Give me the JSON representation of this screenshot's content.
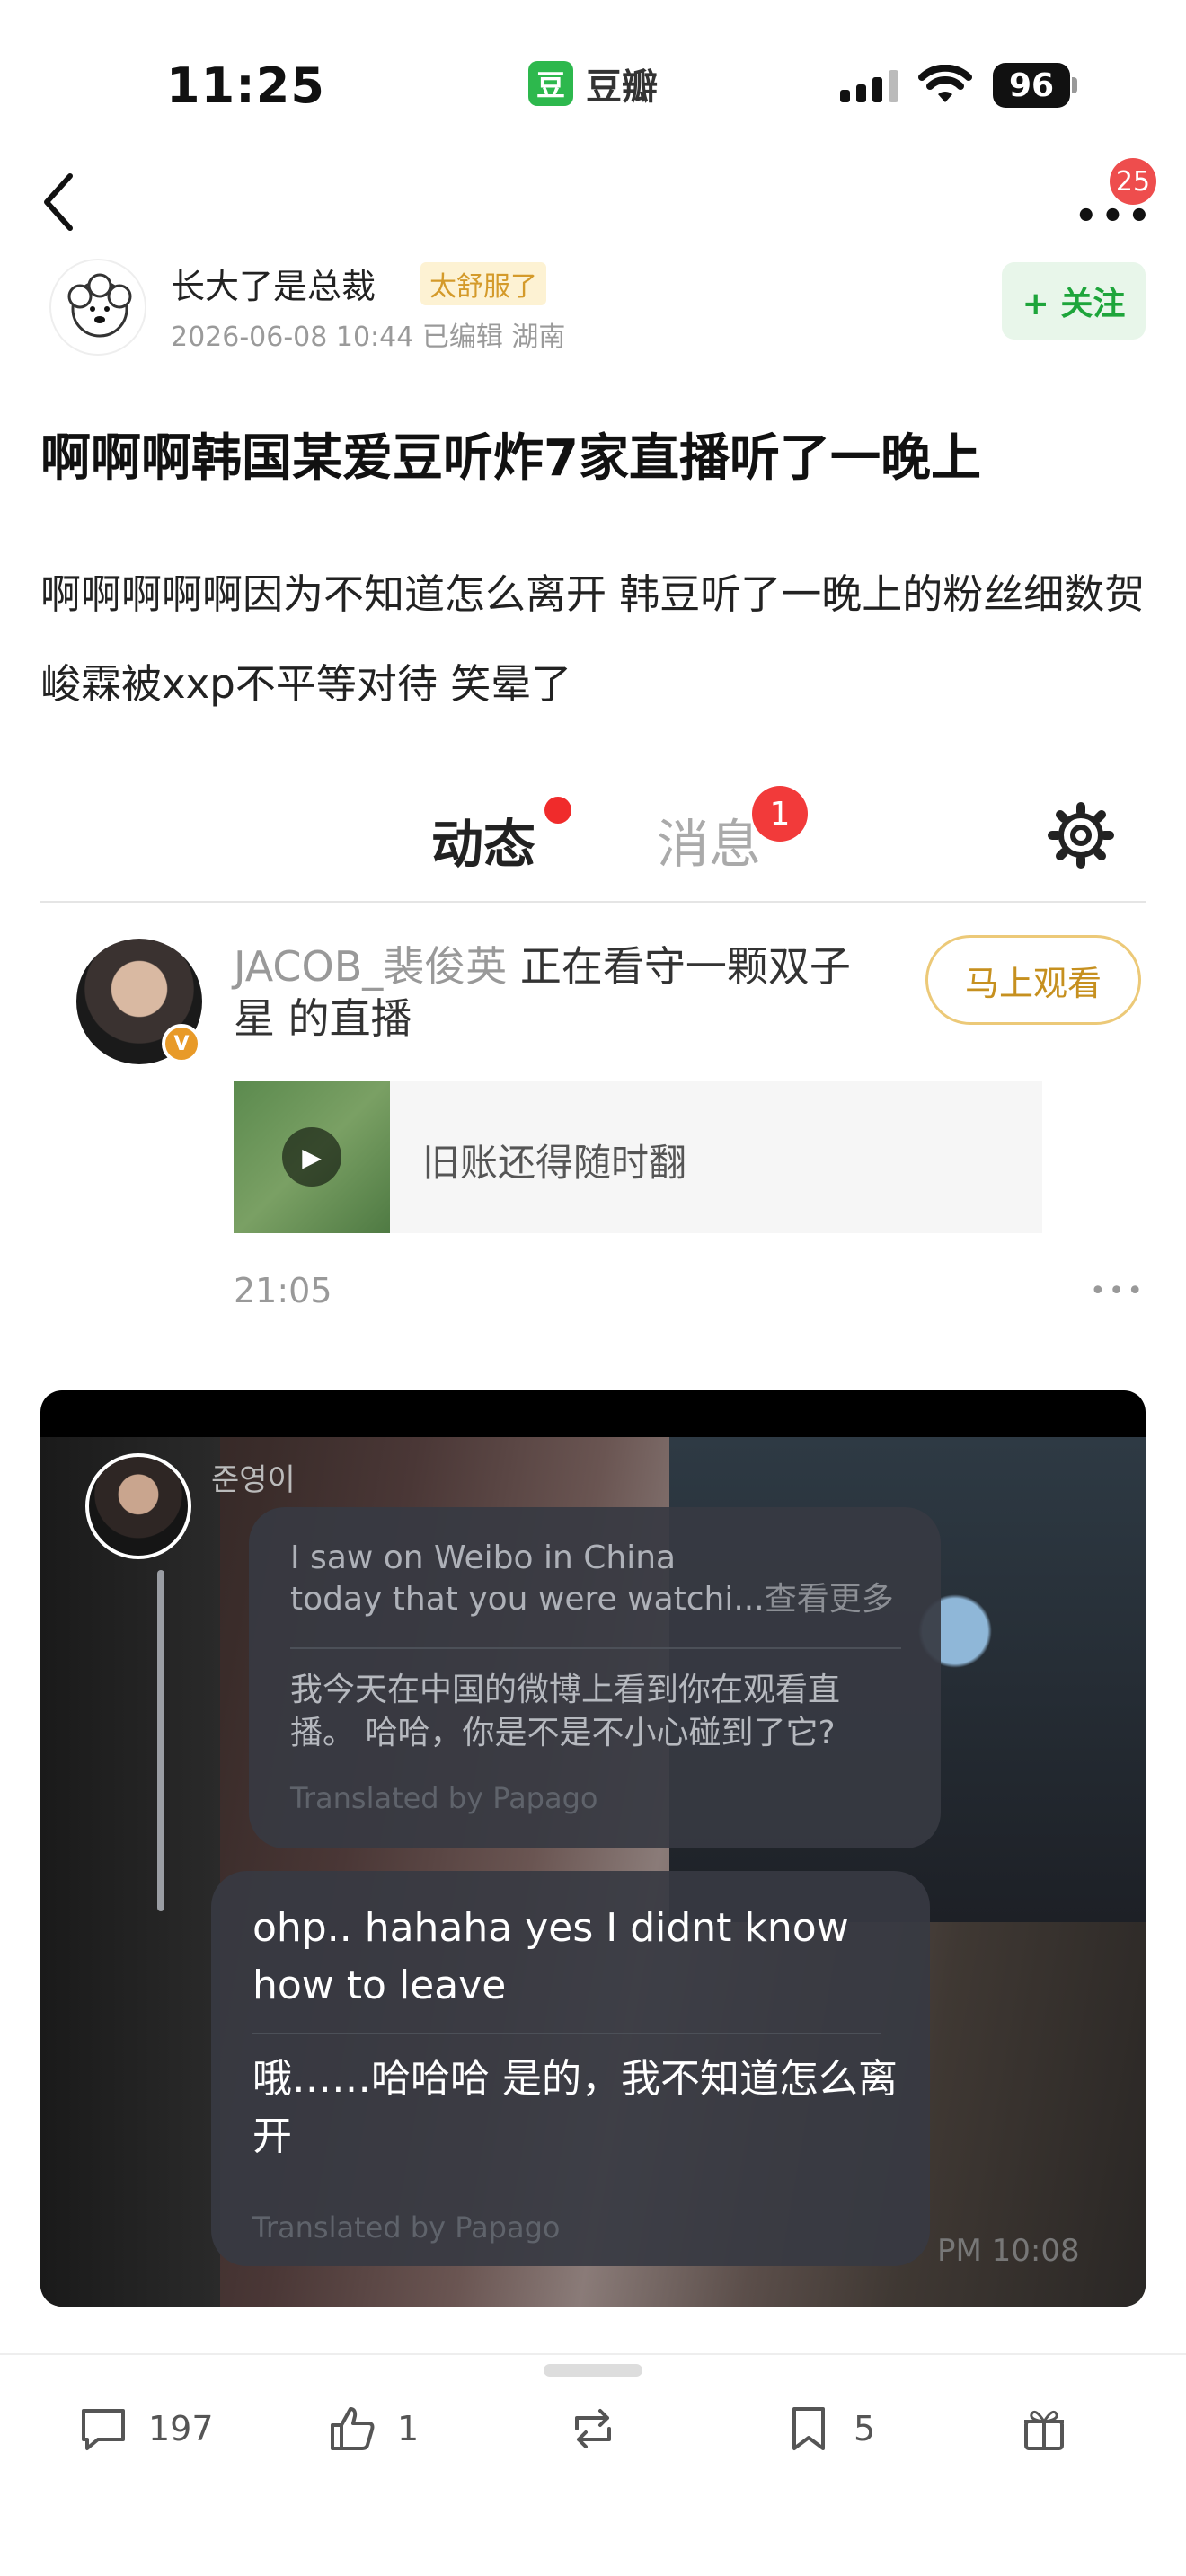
{
  "status_bar": {
    "time": "11:25",
    "battery": "96"
  },
  "app": {
    "logo_char": "豆",
    "name": "豆瓣"
  },
  "nav": {
    "more_badge": "25"
  },
  "author": {
    "name": "长大了是总裁",
    "badge": "太舒服了",
    "meta": "2026-06-08 10:44  已编辑  湖南",
    "follow_label": "+ 关注"
  },
  "post": {
    "title": "啊啊啊韩国某爱豆听炸7家直播听了一晚上",
    "body": "啊啊啊啊啊因为不知道怎么离开 韩豆听了一晚上的粉丝细数贺峻霖被xxp不平等对待 笑晕了"
  },
  "screenshot1": {
    "tab_active": "动态",
    "tab_messages": "消息",
    "messages_badge": "1",
    "live_user": "JACOB_裴俊英",
    "live_text": " 正在看守一颗双子星 的直播",
    "watch_button": "马上观看",
    "share_title": "旧账还得随时翻",
    "time": "21:05"
  },
  "screenshot2": {
    "streamer_name": "준영이",
    "bubble1": {
      "en_line1": "I saw on Weibo in China",
      "en_line2": "today that you were watchi...",
      "see_more": "查看更多",
      "zh": "我今天在中国的微博上看到你在观看直播。 哈哈，你是不是不小心碰到了它?",
      "translated": "Translated by Papago"
    },
    "bubble2": {
      "en": "ohp.. hahaha yes I didnt know how to leave",
      "zh": "哦……哈哈哈 是的，我不知道怎么离开",
      "translated": "Translated by Papago"
    },
    "timestamp": "PM 10:08"
  },
  "bottom_bar": {
    "comments": "197",
    "likes": "1",
    "bookmarks": "5"
  }
}
